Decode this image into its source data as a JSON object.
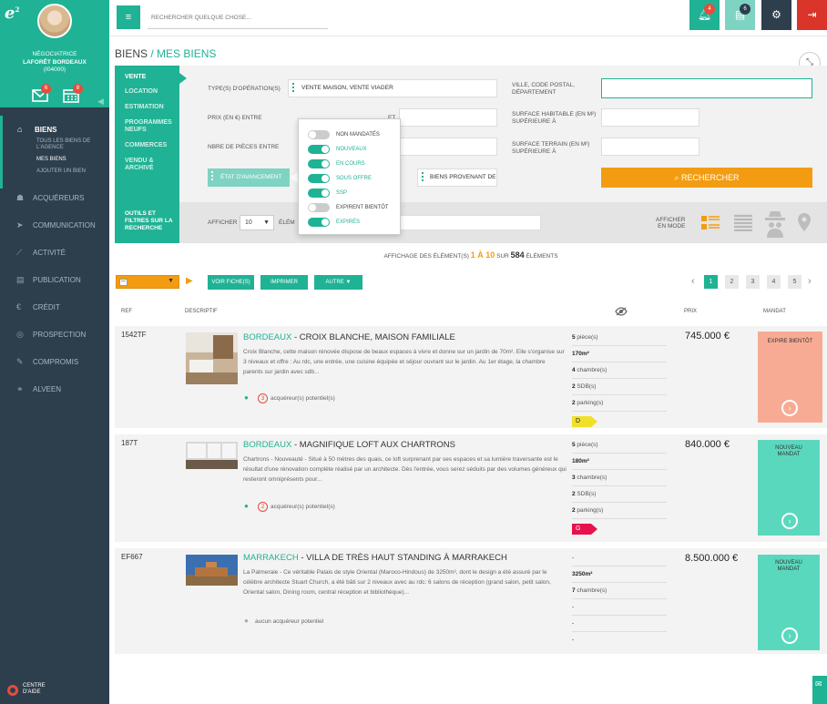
{
  "sidebar": {
    "user_role": "NÉGOCIATRICE",
    "user_agency": "LAFORÊT BORDEAUX",
    "user_code": "(I04000)",
    "mail_count": "6",
    "calendar_count": "8",
    "biens": {
      "title": "BIENS",
      "subs": [
        "TOUS LES BIENS DE",
        "L'AGENCE",
        "MES BIENS",
        "AJOUTER UN BIEN"
      ]
    },
    "items": [
      "ACQUÉREURS",
      "COMMUNICATION",
      "ACTIVITÉ",
      "PUBLICATION",
      "CRÉDIT",
      "PROSPECTION",
      "COMPROMIS",
      "ALVEEN"
    ],
    "help_line1": "CENTRE",
    "help_line2": "D'AIDE"
  },
  "topbar": {
    "search_placeholder": "RECHERCHER QUELQUE CHOSE...",
    "notif_count": "4",
    "docs_count": "6"
  },
  "breadcrumb": {
    "root": "BIENS",
    "sep": " / ",
    "current": "MES BIENS"
  },
  "tabs": [
    "VENTE",
    "LOCATION",
    "ESTIMATION",
    "PROGRAMMES",
    "NEUFS",
    "COMMERCES",
    "VENDU &",
    "ARCHIVÉ"
  ],
  "form": {
    "type_label": "TYPE(S) D'OPÉRATION(S)",
    "type_value": "VENTE MAISON, VENTE VIAGER",
    "prix_label": "PRIX (EN €) ENTRE",
    "et": "ET",
    "pieces_label": "NBRE DE PIÈCES ENTRE",
    "etat_label": "ÉTAT D'AVANCEMENT",
    "ville_label1": "VILLE, CODE POSTAL,",
    "ville_label2": "DÉPARTEMENT",
    "surf_hab1": "SURFACE HABITABLE (EN M²)",
    "surf_hab2": "SUPÉRIEURE À",
    "surf_ter1": "SURFACE TERRAIN (EN M²)",
    "surf_ter2": "SUPÉRIEURE À",
    "provenant": "BIENS PROVENANT DE",
    "search_btn": "RECHERCHER"
  },
  "dropdown": [
    {
      "label": "NON MANDATÉS",
      "on": false,
      "color": "#555555"
    },
    {
      "label": "NOUVEAUX",
      "on": true,
      "color": "#20b294"
    },
    {
      "label": "EN COURS",
      "on": true,
      "color": "#20b294"
    },
    {
      "label": "SOUS OFFRE",
      "on": true,
      "color": "#20b294"
    },
    {
      "label": "SSP",
      "on": true,
      "color": "#20b294"
    },
    {
      "label": "EXPIRENT BIENTÔT",
      "on": false,
      "color": "#555555"
    },
    {
      "label": "EXPIRÉS",
      "on": true,
      "color": "#20b294"
    }
  ],
  "tools": {
    "label_lines": [
      "OUTILS ET",
      "FILTRES SUR LA",
      "RECHERCHE"
    ],
    "afficher": "AFFICHER",
    "per_page": "10",
    "elements": "ÉLÉM",
    "mode1": "AFFICHER",
    "mode2": "EN MODE"
  },
  "count": {
    "pre": "AFFICHAGE DES ÉLÉMENT(S) ",
    "range": "1 À 10",
    "mid": " SUR ",
    "total": "584",
    "post": " ÉLÉMENTS"
  },
  "actions": {
    "voir": "VOIR FICHE(S)",
    "imprimer": "IMPRIMER",
    "autre": "AUTRE ▼"
  },
  "pagination": {
    "prev": "‹",
    "pages": [
      "1",
      "2",
      "3",
      "4",
      "5"
    ],
    "next": "›"
  },
  "columns": {
    "ref": "REF",
    "descriptif": "DESCRIPTIF",
    "prix": "PRIX",
    "mandat": "MANDAT"
  },
  "listings": [
    {
      "ref": "1542TF",
      "city": "BORDEAUX",
      "title": " - CROIX BLANCHE, MAISON FAMILIALE",
      "desc": "Croix Blanche, cette maison rénovée dispose de beaux espaces à vivre et donne sur un jardin de 70m². Elle s'organise sur 3 niveaux et offre : Au rdc, une entrée, une cuisine équipée et séjour ouvrant sur le jardin. Au 1er étage, la chambre parents sur jardin avec sdb...",
      "acq_n": "3",
      "acq_text": "acquéreur(s) potentiel(s)",
      "specs": [
        [
          "5",
          " pièce(s)"
        ],
        [
          "170m²",
          ""
        ],
        [
          "4",
          " chambre(s)"
        ],
        [
          "2",
          " SDB(s)"
        ],
        [
          "2",
          " parking(s)"
        ]
      ],
      "dpe": "D",
      "dpe_color": "#f1e02a",
      "price": "745.000 €",
      "mandat": "EXPIRE BIENTÔT",
      "mandat_color": "#f8ab94"
    },
    {
      "ref": "187T",
      "city": "BORDEAUX",
      "title": " - MAGNIFIQUE LOFT AUX CHARTRONS",
      "desc": "Chartrons - Nouveauté - Situé à 50 mètres des quais, ce loft surprenant par ses espaces et sa lumière traversante est le résultat d'une rénovation complète réalisé par un architecte. Dès l'entrée, vous serez séduits par des volumes généreux qui resteront omniprésents pour...",
      "acq_n": "2",
      "acq_text": "acquéreur(s) potentiel(s)",
      "specs": [
        [
          "5",
          " pièce(s)"
        ],
        [
          "180m²",
          ""
        ],
        [
          "3",
          " chambre(s)"
        ],
        [
          "2",
          " SDB(s)"
        ],
        [
          "2",
          " parking(s)"
        ]
      ],
      "dpe": "G",
      "dpe_color": "#e8124e",
      "price": "840.000 €",
      "mandat": "NOUVEAU MANDAT",
      "mandat_color": "#5ad8bd"
    },
    {
      "ref": "EF667",
      "city": "MARRAKECH",
      "title": " - VILLA DE TRÈS HAUT STANDING À MARRAKECH",
      "desc": "La Palmeraie - Ce véritable Palais de style Oriental (Maroco-Hindous) de 3250m², dont le design a été assuré par le célèbre architecte Stuart Church, a été bâti sur 2 niveaux avec au rdc: 6 salons de réception (grand salon, petit salon, Oriental salon, Dining room, central réception et bibliothèque)...",
      "acq_n": "",
      "acq_text": "aucun acquéreur potentiel",
      "specs": [
        [
          "-",
          ""
        ],
        [
          "3250m²",
          ""
        ],
        [
          "7",
          " chambre(s)"
        ],
        [
          "-",
          ""
        ],
        [
          "-",
          ""
        ],
        [
          "-",
          ""
        ]
      ],
      "dpe": "",
      "dpe_color": "",
      "price": "8.500.000 €",
      "mandat": "NOUVEAU MANDAT",
      "mandat_color": "#5ad8bd"
    }
  ]
}
